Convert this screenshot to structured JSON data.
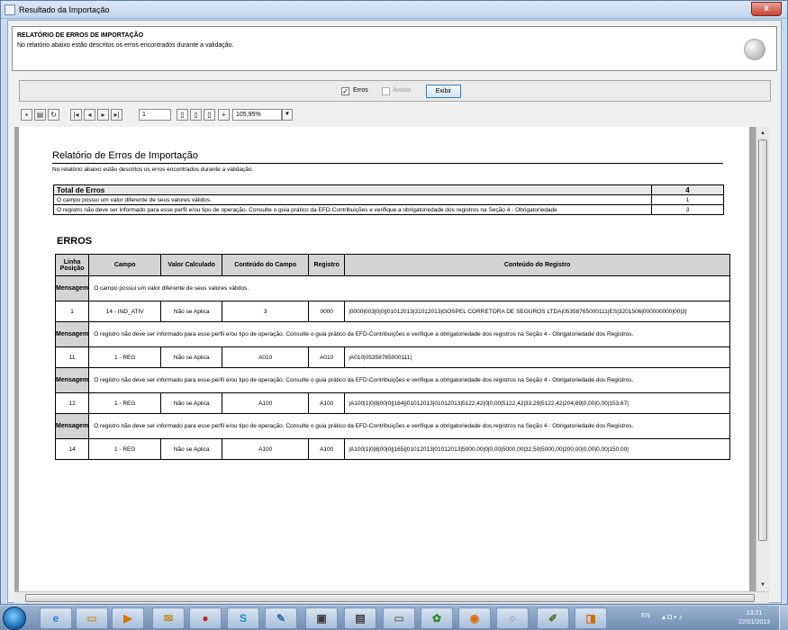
{
  "window": {
    "title": "Resultado da Importação",
    "close_label": "x"
  },
  "header": {
    "title": "RELATÓRIO DE ERROS DE IMPORTAÇÃO",
    "description": "No relatório abaixo estão descritos os erros encontrados durante a validação."
  },
  "filters": {
    "erros_label": "Erros",
    "erros_checked": "✓",
    "avisos_label": "Avisos",
    "exibir_label": "Exibir"
  },
  "toolbar": {
    "page_number": "1",
    "zoom": "105,95%"
  },
  "report": {
    "title": "Relatório de Erros de Importação",
    "description": "No relatório abaixo estão descritos os erros encontrados durante a validação.",
    "totals": {
      "header_label": "Total de Erros",
      "header_value": "4",
      "rows": [
        {
          "text": "O campo possui um valor diferente de seus valores válidos.",
          "count": "1"
        },
        {
          "text": "O registro não deve ser informado para esse perfil e/ou tipo de operação. Consulte o guia prático da EFD-Contribuições e verifique a obrigatoriedade dos registros na Seção 4 - Obrigatoriedade",
          "count": "3"
        }
      ]
    },
    "errors_heading": "ERROS",
    "columns": {
      "linha": "Linha",
      "posicao": "Posição",
      "campo": "Campo",
      "valor": "Valor Calculado",
      "conteudo_campo": "Conteúdo do Campo",
      "registro": "Registro",
      "conteudo_registro": "Conteúdo do Registro"
    },
    "message_label": "Mensagem",
    "groups": [
      {
        "message": "O campo possui um valor diferente de seus valores válidos.",
        "linha": "1",
        "campo": "14 - IND_ATIV",
        "valor": "Não se Aplica",
        "conteudo_campo": "3",
        "registro": "0000",
        "conteudo_registro": "|0000|003|0|0||01012013|31012013|GOSPEL CORRETORA DE SEGUROS LTDA|05358765000111|ES|3201506|000000000|00|3|"
      },
      {
        "message": "O registro não deve ser informado para esse perfil e/ou tipo de operação. Consulte o guia prático da EFD-Contribuições e verifique a obrigatoriedade dos registros na Seção 4 - Obrigatoriedade dos Registros.",
        "linha": "11",
        "campo": "1 - REG",
        "valor": "Não se Aplica",
        "conteudo_campo": "A010",
        "registro": "A010",
        "conteudo_registro": "|A010|05358765000111|"
      },
      {
        "message": "O registro não deve ser informado para esse perfil e/ou tipo de operação. Consulte o guia prático da EFD-Contribuições e verifique a obrigatoriedade dos registros na Seção 4 - Obrigatoriedade dos Registros.",
        "linha": "12",
        "campo": "1 - REG",
        "valor": "Não se Aplica",
        "conteudo_campo": "A100",
        "registro": "A100",
        "conteudo_registro": "|A100|1|0|8|00|0||164||01012013|01012013|5122,42|0|0,00|5122,42|33,29|5122,42|204,89|0,00|0,00|153,67|"
      },
      {
        "message": "O registro não deve ser informado para esse perfil e/ou tipo de operação. Consulte o guia prático da EFD-Contribuições e verifique a obrigatoriedade dos registros na Seção 4 - Obrigatoriedade dos Registros.",
        "linha": "14",
        "campo": "1 - REG",
        "valor": "Não se Aplica",
        "conteudo_campo": "A100",
        "registro": "A100",
        "conteudo_registro": "|A100|1|0|8|00|0||165||01012013|01012013|5000,00|0|0,00|5000,00|32,50|5000,00|200,00|0,00|0,00|150,00|"
      }
    ]
  },
  "taskbar": {
    "lang": "EN",
    "time": "13:21",
    "date": "22/01/2013"
  }
}
